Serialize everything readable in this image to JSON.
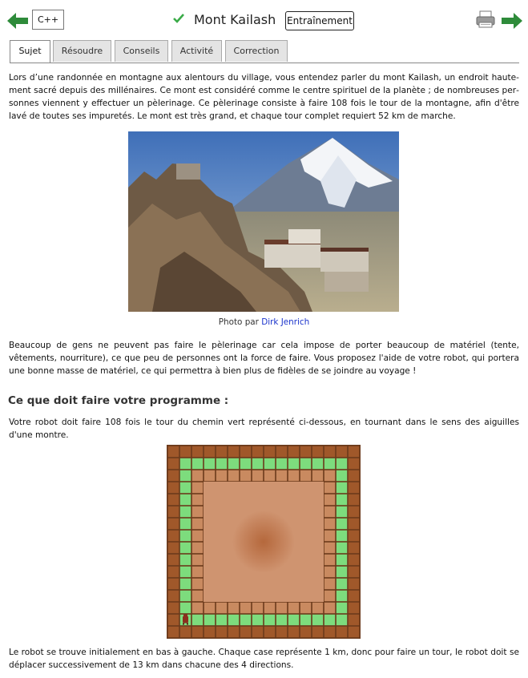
{
  "header": {
    "language": "C++",
    "title": "Mont Kailash",
    "mode_label": "Entraînement",
    "colors": {
      "arrow": "#2e8b3a",
      "check": "#3aab48"
    }
  },
  "tabs": [
    {
      "label": "Sujet",
      "active": true
    },
    {
      "label": "Résoudre",
      "active": false
    },
    {
      "label": "Conseils",
      "active": false
    },
    {
      "label": "Activité",
      "active": false
    },
    {
      "label": "Correction",
      "active": false
    }
  ],
  "content": {
    "intro": "Lors d’une randonnée en montagne aux alentours du village, vous entendez parler du mont Kailash, un endroit haute­ment sacré depuis des millénaires. Ce mont est considéré comme le centre spirituel de la planète ; de nombreuses per­sonnes viennent y effectuer un pèlerinage. Ce pèlerinage consiste à faire 108 fois le tour de la montagne, afin d'être lavé de toutes ses impuretés. Le mont est très grand, et chaque tour complet requiert 52 km de marche.",
    "caption_prefix": "Photo par",
    "caption_author": "Dirk Jenrich",
    "para2": "Beaucoup de gens ne peuvent pas faire le pèlerinage car cela impose de porter beaucoup de matériel (tente, vêtements, nourriture), ce que peu de personnes ont la force de faire. Vous proposez l'aide de votre robot, qui portera une bonne masse de matériel, ce qui permettra à bien plus de fidèles de se joindre au voyage !",
    "heading": "Ce que doit faire votre programme :",
    "para3": "Votre robot doit faire 108 fois le tour du chemin vert représenté ci-dessous, en tournant dans le sens des aiguilles d'une montre.",
    "para4": "Le robot se trouve initialement en bas à gauche. Chaque case représente 1 km, donc pour faire un tour, le robot doit se déplacer successivement de 13 km dans chacune des 4 directions."
  },
  "grid": {
    "size": 16,
    "path_ring": 1,
    "mountain_from": 3,
    "mountain_to": 12,
    "robot": {
      "row": 14,
      "col": 1
    },
    "colors": {
      "wall": "#a0582a",
      "path": "#7ddc7d",
      "ground": "#c98a60",
      "mountain": "#cf9470",
      "line": "#6b3a1c"
    }
  }
}
